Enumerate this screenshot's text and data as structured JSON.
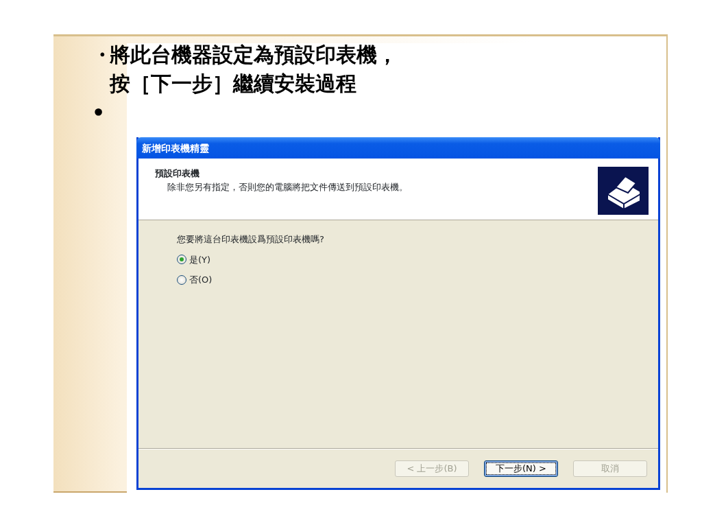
{
  "slide": {
    "bullets": [
      {
        "marker": "・",
        "lines": [
          "將此台機器設定為預設印表機，",
          "按［下一步］繼續安裝過程"
        ]
      },
      {
        "marker": "•"
      }
    ]
  },
  "dialog": {
    "title": "新增印表機精靈",
    "header": {
      "title": "預設印表機",
      "subtitle": "除非您另有指定，否則您的電腦將把文件傳送到預設印表機。"
    },
    "question": "您要將這台印表機設爲預設印表機嗎?",
    "options": [
      {
        "label": "是(Y)",
        "selected": true
      },
      {
        "label": "否(O)",
        "selected": false
      }
    ],
    "buttons": [
      {
        "label": "< 上一步(B)",
        "disabled": true,
        "default": false
      },
      {
        "label": "下一步(N) >",
        "disabled": false,
        "default": true
      },
      {
        "label": "取消",
        "disabled": true,
        "default": false
      }
    ]
  }
}
